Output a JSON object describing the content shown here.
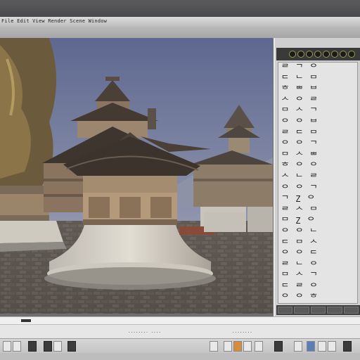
{
  "menu": {
    "text": "File  Edit  View  Render  Scene  Window"
  },
  "side_panel": {
    "glyph_rows": [
      "ᄅ ᄀ ᄋ",
      "ᄃ ᄂ ᄆ",
      "ᄒ ᄈ ᄇ",
      "ᄉ ᄋ ᄅ",
      "ᄆ ᄉ ᄀ",
      "ᄋ ᄋ ᄇ",
      "ᄅ ᄃ ᄆ",
      "ᄋ ᄋ ᄀ",
      "ᄆ ᄉ ᄈ",
      "ᄒ ᄋ ᄋ",
      "ᄉ ᄂ ᄅ",
      "ᄋ ᄋ ᄀ",
      "ᄀ Z ᄋ",
      "ᄅ ᄉ ᄆ",
      "ᄆ Z ᄋ",
      "ᄋ ᄋ ᄂ",
      "ᄃ ᄆ ᄉ",
      "ᄋ ᄋ ᄃ",
      "ᄅ ᄂ ᄋ",
      "ᄆ ᄉ ᄀ",
      "ᄃ ᄅ ᄋ",
      "ᄋ ᄋ ᄒ"
    ]
  },
  "status": {
    "label_a": "........ ....",
    "label_b": "........"
  },
  "colors": {
    "sky_top": "#6a7398",
    "sky_bottom": "#a8aec0",
    "roof": "#4a4038",
    "pavement": "#5e5852"
  }
}
